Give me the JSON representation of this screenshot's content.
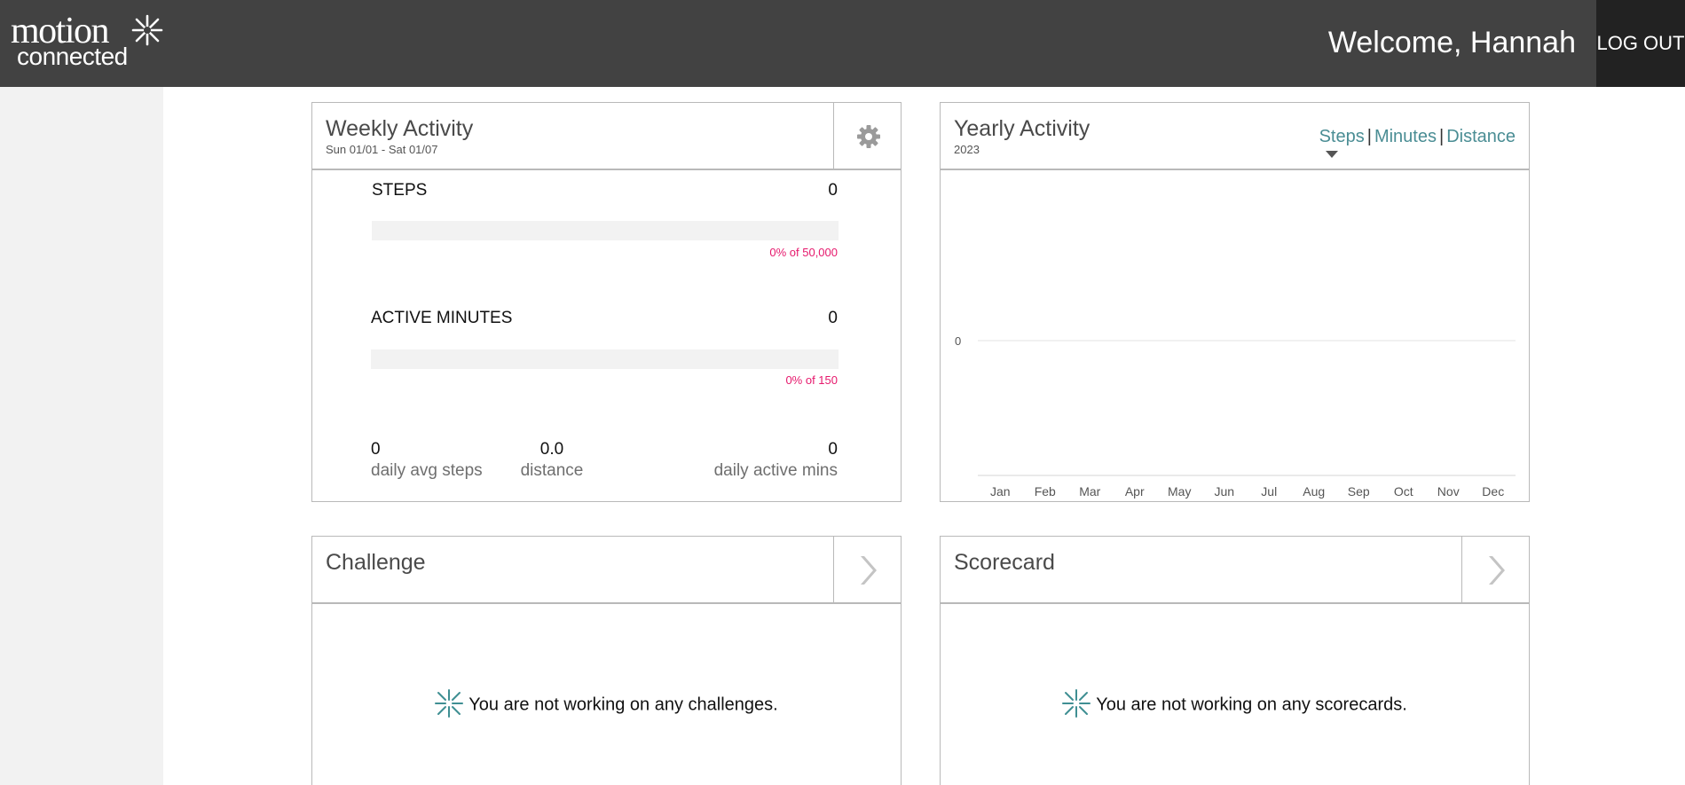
{
  "brand": {
    "logo_word1": "motion",
    "logo_word2": "connected",
    "logo_mark_icon": "asterisk-star-icon"
  },
  "header": {
    "welcome_text": "Welcome, Hannah",
    "logout_label": "LOG OUT"
  },
  "colors": {
    "header_bg": "#424242",
    "logout_bg": "#222222",
    "accent_teal": "#4a8d94",
    "progress_pink": "#e6186c",
    "sidebar_bg": "#f2f2f2"
  },
  "weekly": {
    "title": "Weekly Activity",
    "date_range": "Sun 01/01 - Sat 01/07",
    "settings_icon": "gear-icon",
    "steps": {
      "label": "STEPS",
      "value": "0",
      "progress_percent": 0,
      "caption": "0% of 50,000"
    },
    "active_minutes": {
      "label": "ACTIVE MINUTES",
      "value": "0",
      "progress_percent": 0,
      "caption": "0% of 150"
    },
    "stats": [
      {
        "value": "0",
        "label": "daily avg steps"
      },
      {
        "value": "0.0",
        "label": "distance"
      },
      {
        "value": "0",
        "label": "daily active mins"
      }
    ]
  },
  "yearly": {
    "title": "Yearly Activity",
    "year": "2023",
    "tabs": [
      "Steps",
      "Minutes",
      "Distance"
    ],
    "selected_tab": "Steps"
  },
  "chart_data": {
    "type": "line",
    "title": "Yearly Activity",
    "categories": [
      "Jan",
      "Feb",
      "Mar",
      "Apr",
      "May",
      "Jun",
      "Jul",
      "Aug",
      "Sep",
      "Oct",
      "Nov",
      "Dec"
    ],
    "y_ticks": [
      "0"
    ],
    "series": [
      {
        "values": [
          0,
          0,
          0,
          0,
          0,
          0,
          0,
          0,
          0,
          0,
          0,
          0
        ]
      }
    ],
    "grid": true,
    "legend": "none"
  },
  "challenge": {
    "title": "Challenge",
    "nav_icon": "chevron-right-icon",
    "empty_text": "You are not working on any challenges.",
    "empty_icon": "asterisk-star-icon"
  },
  "scorecard": {
    "title": "Scorecard",
    "nav_icon": "chevron-right-icon",
    "empty_text": "You are not working on any scorecards.",
    "empty_icon": "asterisk-star-icon"
  }
}
